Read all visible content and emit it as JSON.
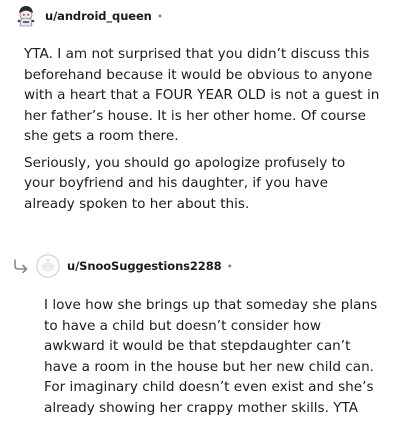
{
  "comment": {
    "username": "u/android_queen",
    "separator": "•",
    "paragraphs": [
      "YTA. I am not surprised that you didn’t discuss this beforehand because it would be obvious to anyone with a heart that a FOUR YEAR OLD is not a guest in her father’s house. It is her other home. Of course she gets a room there.",
      "Seriously, you should go apologize profusely to your boyfriend and his daughter, if you have already spoken to her about this."
    ]
  },
  "reply": {
    "username": "u/SnooSuggestions2288",
    "separator": "•",
    "paragraphs": [
      "I love how she brings up that someday she plans to have a child but doesn’t consider how awkward it would be that stepdaughter can’t have a room in the house but her new child can. For imaginary child doesn’t even exist and she’s already showing her crappy mother skills. YTA"
    ]
  },
  "colors": {
    "text": "#1c1c1c",
    "meta_gray": "#878a8c",
    "avatar_gray": "#d7d9dc"
  },
  "icons": {
    "user_avatar": "snoo-avatar-icon",
    "reply_indicator": "reply-arrow-icon",
    "reply_avatar": "default-avatar-icon"
  }
}
